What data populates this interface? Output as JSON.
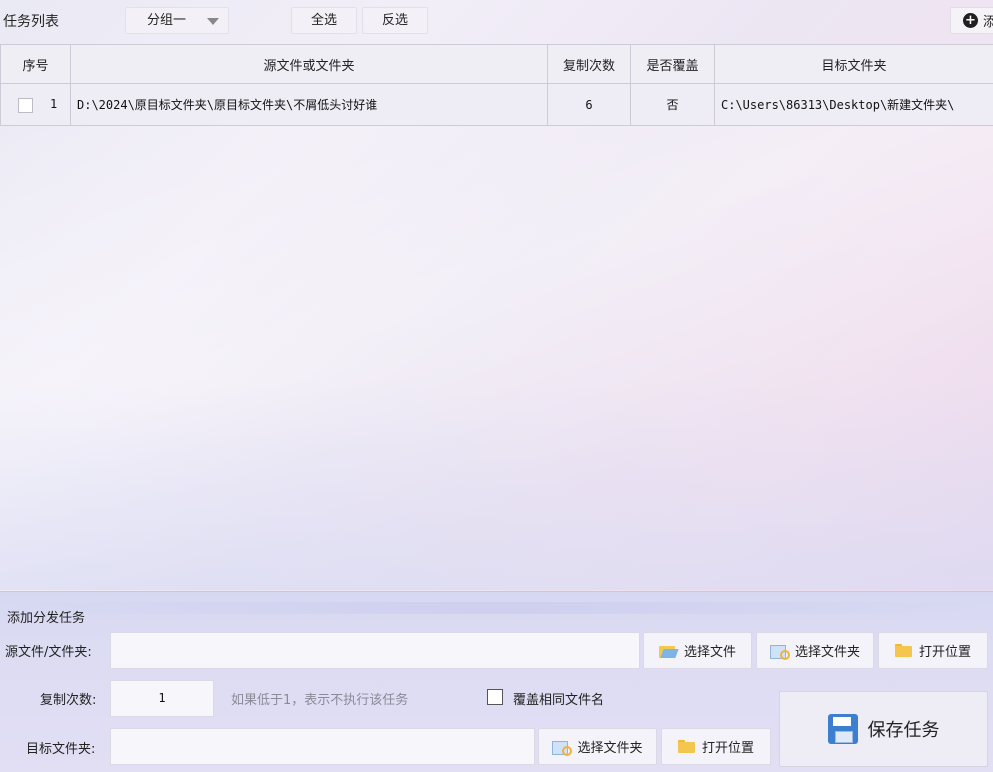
{
  "toolbar": {
    "title": "任务列表",
    "group_select": "分组一",
    "select_all": "全选",
    "invert_select": "反选",
    "right_button_fragment": "添"
  },
  "table": {
    "headers": [
      "序号",
      "源文件或文件夹",
      "复制次数",
      "是否覆盖",
      "目标文件夹"
    ],
    "rows": [
      {
        "no": "1",
        "source": "D:\\2024\\原目标文件夹\\原目标文件夹\\不屑低头讨好谁",
        "copies": "6",
        "overwrite": "否",
        "target": "C:\\Users\\86313\\Desktop\\新建文件夹\\"
      }
    ]
  },
  "panel": {
    "title": "添加分发任务",
    "source_label": "源文件/文件夹:",
    "source_value": "",
    "select_file": "选择文件",
    "select_folder": "选择文件夹",
    "open_location": "打开位置",
    "copies_label": "复制次数:",
    "copies_value": "1",
    "copies_hint": "如果低于1，表示不执行该任务",
    "overwrite_label": "覆盖相同文件名",
    "target_label": "目标文件夹:",
    "target_value": "",
    "target_select_folder": "选择文件夹",
    "target_open_location": "打开位置",
    "save_task": "保存任务"
  }
}
